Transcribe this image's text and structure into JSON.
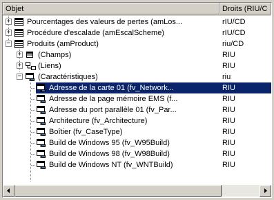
{
  "header": {
    "col_object": "Objet",
    "col_rights": "Droits (RIU/C"
  },
  "rows": [
    {
      "label": "Pourcentages des valeurs de pertes (amLos...",
      "rights": "rIU/CD",
      "icon": "table-icon",
      "expander": "+"
    },
    {
      "label": "Procédure d'escalade (amEscalScheme)",
      "rights": "rIU/CD",
      "icon": "table-icon",
      "expander": "+"
    },
    {
      "label": "Produits (amProduct)",
      "rights": "riu/CD",
      "icon": "table-icon",
      "expander": "−"
    },
    {
      "label": "(Champs)",
      "rights": "RIU",
      "icon": "fields-icon",
      "expander": "+"
    },
    {
      "label": "(Liens)",
      "rights": "RIU",
      "icon": "links-icon",
      "expander": "+"
    },
    {
      "label": "(Caractéristiques)",
      "rights": "riu",
      "icon": "features-icon",
      "expander": "−"
    },
    {
      "label": "Adresse de la carte 01 (fv_Network...",
      "rights": "RIU",
      "icon": "feature-item-icon",
      "selected": true
    },
    {
      "label": "Adresse de la page mémoire EMS (f...",
      "rights": "RIU",
      "icon": "feature-item-icon"
    },
    {
      "label": "Adresse du port parallèle 01 (fv_Par...",
      "rights": "RIU",
      "icon": "feature-item-icon"
    },
    {
      "label": "Architecture (fv_Architecture)",
      "rights": "RIU",
      "icon": "feature-item-icon"
    },
    {
      "label": "Boîtier (fv_CaseType)",
      "rights": "RIU",
      "icon": "feature-item-icon"
    },
    {
      "label": "Build de Windows 95 (fv_W95Build)",
      "rights": "RIU",
      "icon": "feature-item-icon"
    },
    {
      "label": "Build de Windows 98 (fv_W98Build)",
      "rights": "RIU",
      "icon": "feature-item-icon"
    },
    {
      "label": "Build de Windows NT (fv_WNTBuild)",
      "rights": "RIU",
      "icon": "feature-item-icon"
    }
  ],
  "scrollbar": {
    "left_arrow": "◂",
    "right_arrow": "▸"
  },
  "colors": {
    "selection": "#0a246a",
    "face": "#d4d0c8"
  }
}
